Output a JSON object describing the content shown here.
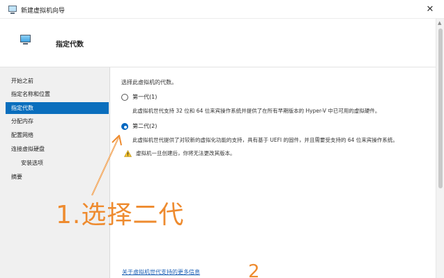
{
  "window": {
    "title": "新建虚拟机向导",
    "close_glyph": "✕"
  },
  "header": {
    "title": "指定代数"
  },
  "sidebar": {
    "items": [
      {
        "label": "开始之前",
        "selected": false,
        "sub": false
      },
      {
        "label": "指定名称和位置",
        "selected": false,
        "sub": false
      },
      {
        "label": "指定代数",
        "selected": true,
        "sub": false
      },
      {
        "label": "分配内存",
        "selected": false,
        "sub": false
      },
      {
        "label": "配置网络",
        "selected": false,
        "sub": false
      },
      {
        "label": "连接虚拟硬盘",
        "selected": false,
        "sub": false
      },
      {
        "label": "安装选项",
        "selected": false,
        "sub": true
      },
      {
        "label": "摘要",
        "selected": false,
        "sub": false
      }
    ]
  },
  "content": {
    "prompt": "选择此虚拟机的代数。",
    "gen1": {
      "label": "第一代(1)",
      "checked": false,
      "description": "此虚拟机世代支持 32 位和 64 位来宾操作系统并提供了在所有早期版本的 Hyper-V 中已可用的虚拟硬件。"
    },
    "gen2": {
      "label": "第二代(2)",
      "checked": true,
      "description": "此虚拟机世代提供了对较新的虚拟化功能的支持，具有基于 UEFI 的固件，并且需要受支持的 64 位来宾操作系统。"
    },
    "warning": "虚拟机一旦创建后，你将无法更改其版本。",
    "more_link": "关于虚拟机世代支持的更多信息"
  },
  "annotations": {
    "step1": "1.选择二代",
    "step2": "2",
    "color": "#ee8b2f"
  },
  "colors": {
    "selected_bg": "#0a6ebd",
    "link": "#1a5fb4"
  }
}
